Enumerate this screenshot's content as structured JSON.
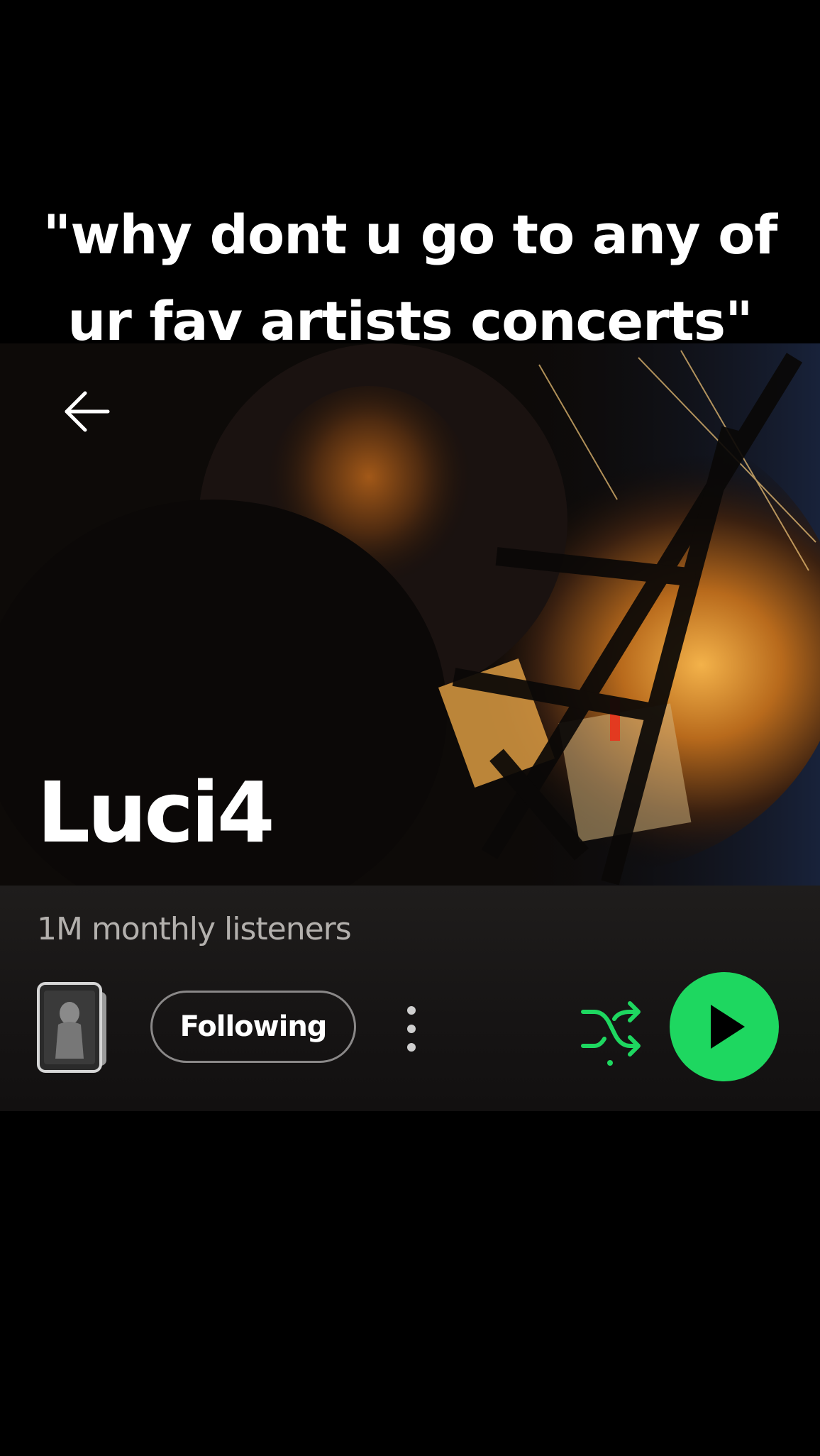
{
  "caption": {
    "line1": "\"why dont u go to any of",
    "line2": "ur fav artists concerts\""
  },
  "header": {
    "back_icon": "arrow-left-icon"
  },
  "artist": {
    "name": "Luci4",
    "monthly_listeners": "1M monthly listeners"
  },
  "actions": {
    "cover_icon": "artist-cover-thumbnail",
    "follow_label": "Following",
    "more_icon": "more-vertical-icon",
    "shuffle_icon": "shuffle-icon",
    "play_icon": "play-icon"
  },
  "colors": {
    "accent": "#1ed760",
    "panel": "#1b1918",
    "subtext": "#b3b0ad"
  }
}
